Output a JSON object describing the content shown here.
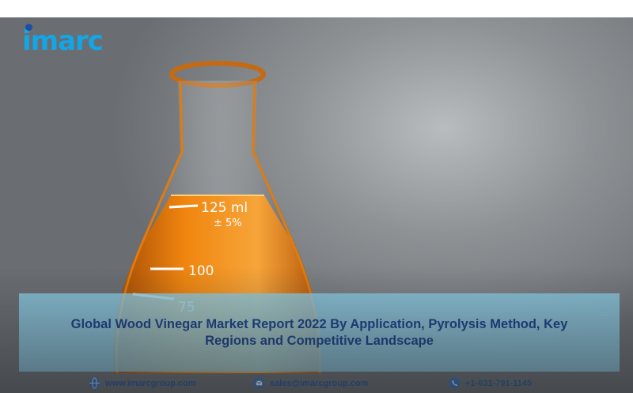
{
  "brand": {
    "logo_text": "imarc",
    "colors": {
      "logo_primary": "#12a6e6",
      "logo_dot": "#1b4fa5",
      "title": "#183f86",
      "title_box": "#8ccee8"
    }
  },
  "hero": {
    "flask_markings": [
      "125 ml",
      "± 5%",
      "100",
      "75"
    ],
    "liquid_color": "#e8780e"
  },
  "report": {
    "title": "Global Wood Vinegar Market Report 2022 By Application, Pyrolysis Method, Key Regions and Competitive Landscape"
  },
  "contacts": {
    "website": {
      "icon": "globe-icon",
      "text": "www.imarcgroup.com"
    },
    "email": {
      "icon": "envelope-icon",
      "text": "sales@imarcgroup.com"
    },
    "phone": {
      "icon": "phone-icon",
      "text": "+1-631-791-1145"
    }
  }
}
